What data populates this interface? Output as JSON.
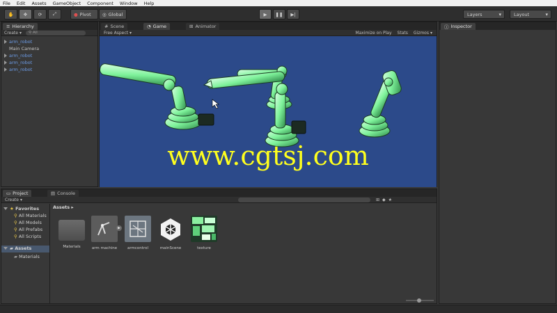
{
  "menu": [
    "File",
    "Edit",
    "Assets",
    "GameObject",
    "Component",
    "Window",
    "Help"
  ],
  "toolbar": {
    "pivot": "Pivot",
    "global": "Global",
    "layers": "Layers",
    "layout": "Layout"
  },
  "hierarchy": {
    "tab": "Hierarchy",
    "create": "Create",
    "search": "All",
    "items": [
      {
        "label": "arm_robot",
        "prefab": true
      },
      {
        "label": "Main Camera",
        "prefab": false
      },
      {
        "label": "arm_robot",
        "prefab": true
      },
      {
        "label": "arm_robot",
        "prefab": true
      },
      {
        "label": "arm_robot",
        "prefab": true
      }
    ]
  },
  "views": {
    "scene_tab": "Scene",
    "game_tab": "Game",
    "animator_tab": "Animator",
    "aspect": "Free Aspect",
    "maximize": "Maximize on Play",
    "stats": "Stats",
    "gizmos": "Gizmos",
    "watermark": "www.cgtsj.com"
  },
  "inspector": {
    "tab": "Inspector"
  },
  "project": {
    "tab": "Project",
    "console_tab": "Console",
    "create": "Create",
    "favorites": "Favorites",
    "favorite_items": [
      "All Materials",
      "All Models",
      "All Prefabs",
      "All Scripts"
    ],
    "assets_root": "Assets",
    "assets_children": [
      "Materials"
    ],
    "breadcrumb": "Assets",
    "assets": [
      {
        "label": "Materials",
        "kind": "folder"
      },
      {
        "label": "arm machine",
        "kind": "model"
      },
      {
        "label": "armcontrol",
        "kind": "animator"
      },
      {
        "label": "mainScene",
        "kind": "unity"
      },
      {
        "label": "texture",
        "kind": "texture"
      }
    ]
  },
  "colors": {
    "game_bg": "#2c4a8a",
    "watermark": "#ffff1e",
    "prefab_text": "#6d9de8",
    "robot": "#7ef29a"
  }
}
